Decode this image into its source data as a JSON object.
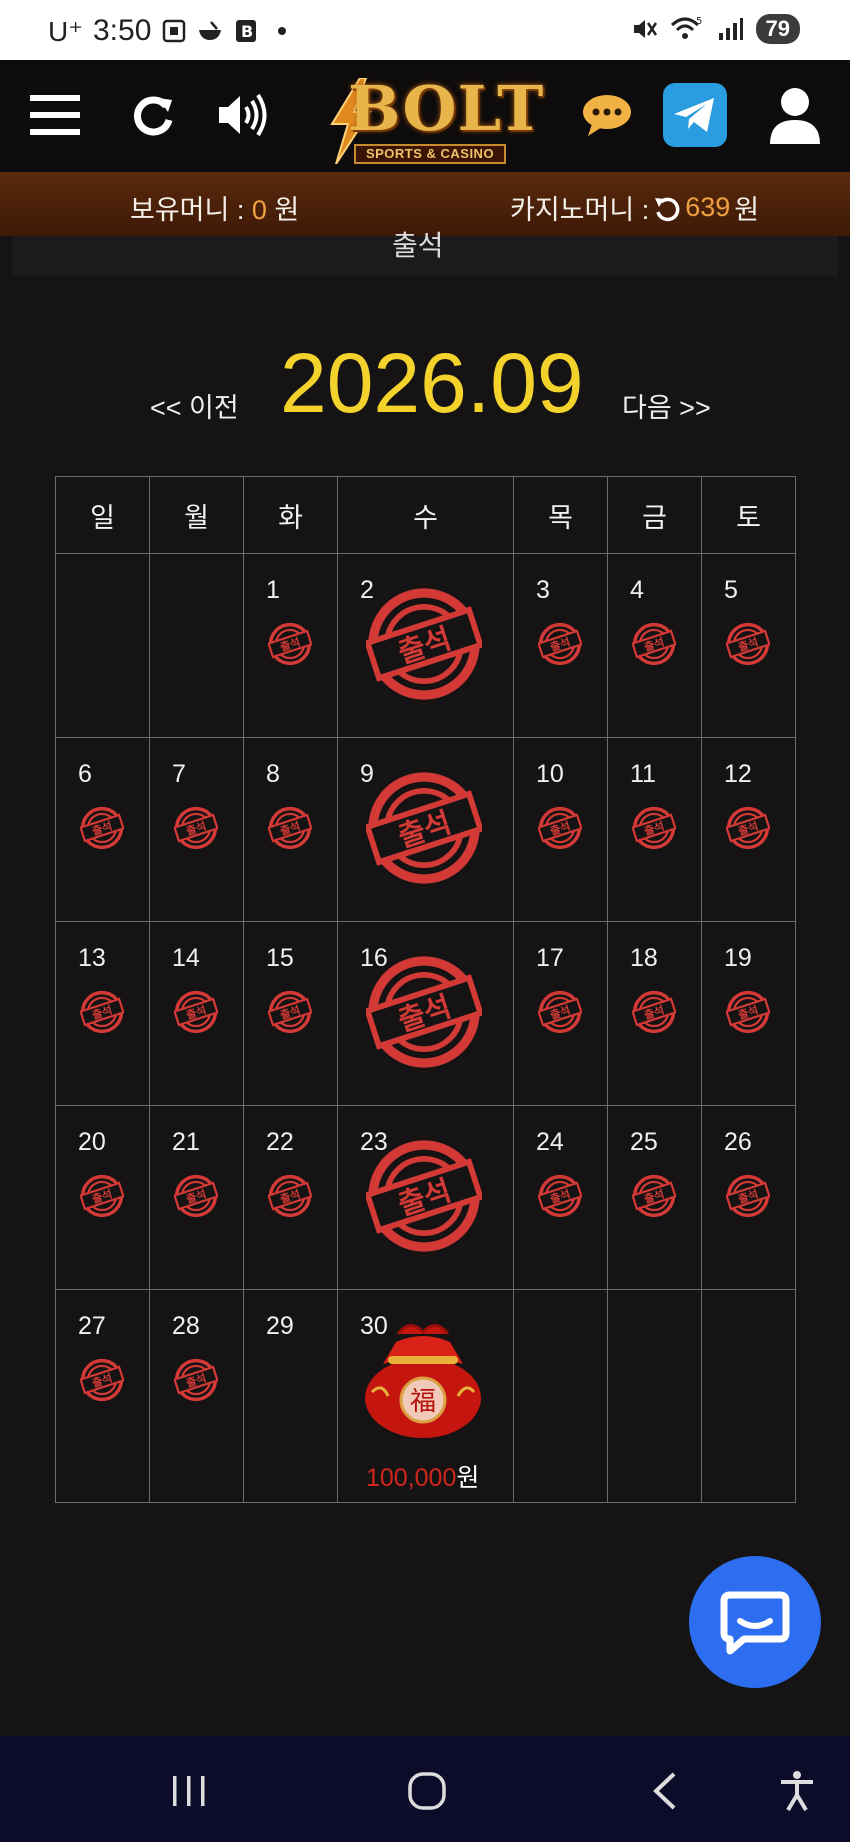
{
  "status_bar": {
    "carrier": "U⁺",
    "time": "3:50",
    "battery": "79",
    "signal": "5"
  },
  "header": {
    "logo_text": "BOLT",
    "logo_subtitle": "SPORTS & CASINO",
    "icons": [
      "menu-icon",
      "refresh-icon",
      "sound-icon",
      "chat-icon",
      "telegram-icon",
      "user-icon"
    ]
  },
  "money": {
    "hold_label": "보유머니 : ",
    "hold_value": "0",
    "hold_unit": " 원",
    "casino_label": "카지노머니 : ",
    "casino_value": "639",
    "casino_unit": " 원"
  },
  "subpanel_text": "출석",
  "calendar": {
    "prev_label": "<< 이전",
    "month": "2026.09",
    "next_label": "다음 >>",
    "weekdays": [
      "일",
      "월",
      "화",
      "수",
      "목",
      "금",
      "토"
    ],
    "weeks": [
      [
        "",
        "",
        "1",
        "2",
        "3",
        "4",
        "5"
      ],
      [
        "6",
        "7",
        "8",
        "9",
        "10",
        "11",
        "12"
      ],
      [
        "13",
        "14",
        "15",
        "16",
        "17",
        "18",
        "19"
      ],
      [
        "20",
        "21",
        "22",
        "23",
        "24",
        "25",
        "26"
      ],
      [
        "27",
        "28",
        "29",
        "30",
        "",
        "",
        ""
      ]
    ],
    "stamp_text": "출석",
    "reward_amount": "100,000",
    "reward_unit": "원",
    "reward_icon": "lucky-bag-icon"
  },
  "colors": {
    "accent": "#f4d22c",
    "money": "#f0a140",
    "stamp": "#d33a35",
    "chat_button": "#2d6ef0"
  }
}
